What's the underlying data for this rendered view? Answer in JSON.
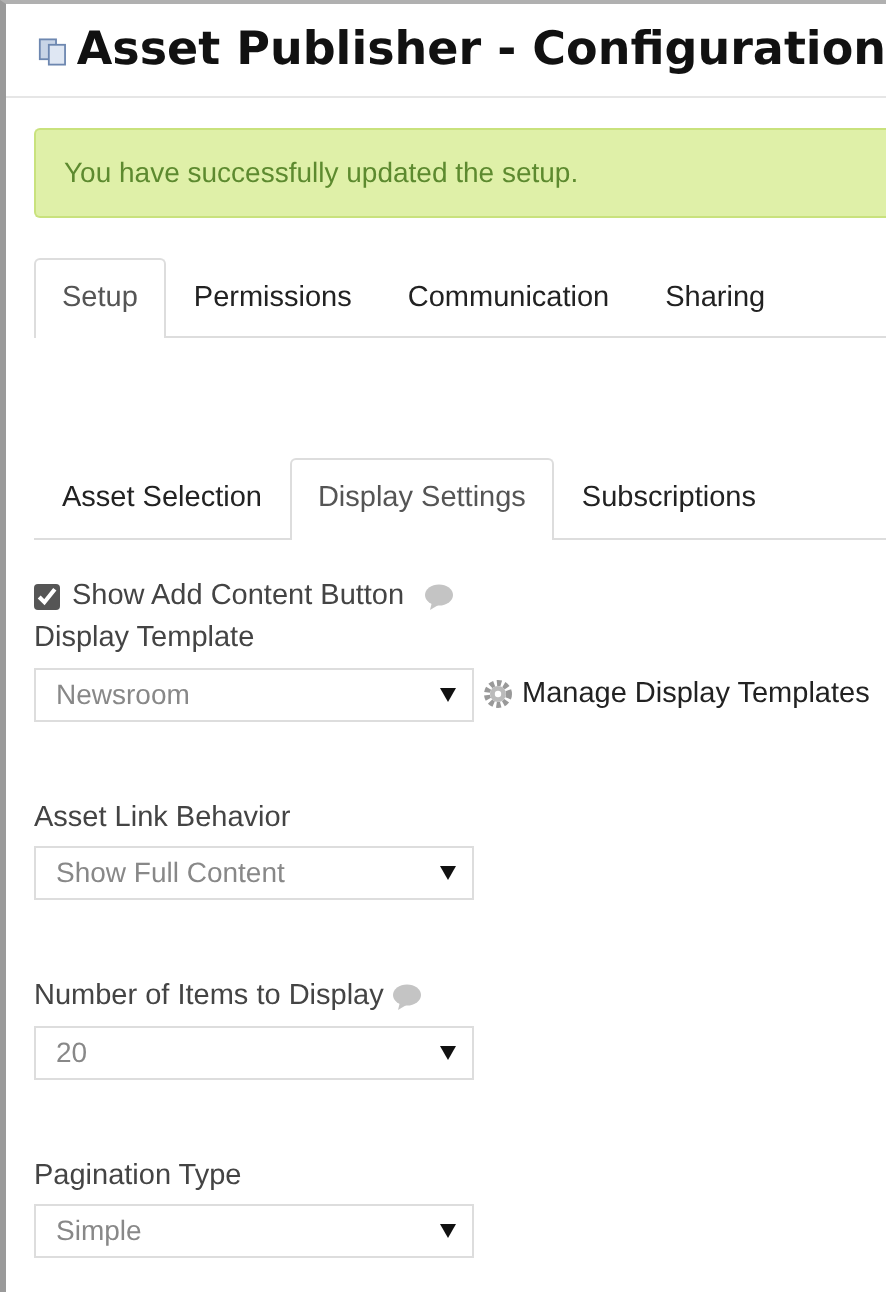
{
  "window": {
    "title": "Asset Publisher - Configuration"
  },
  "alert": {
    "message": "You have successfully updated the setup."
  },
  "tabs": [
    {
      "label": "Setup",
      "selected": true
    },
    {
      "label": "Permissions",
      "selected": false
    },
    {
      "label": "Communication",
      "selected": false
    },
    {
      "label": "Sharing",
      "selected": false
    }
  ],
  "subtabs": [
    {
      "label": "Asset Selection",
      "selected": false
    },
    {
      "label": "Display Settings",
      "selected": true
    },
    {
      "label": "Subscriptions",
      "selected": false
    }
  ],
  "settings": [
    {
      "kind": "checkbox",
      "label": "Show Add Content Button",
      "checked": true,
      "help": true
    },
    {
      "kind": "select",
      "label": "Display Template",
      "value": "Newsroom",
      "help": false,
      "link": "Manage Display Templates"
    },
    {
      "kind": "select",
      "label": "Asset Link Behavior",
      "value": "Show Full Content",
      "help": false
    },
    {
      "kind": "select",
      "label": "Number of Items to Display",
      "value": "20",
      "help": true
    },
    {
      "kind": "select",
      "label": "Pagination Type",
      "value": "Simple",
      "help": false
    }
  ]
}
